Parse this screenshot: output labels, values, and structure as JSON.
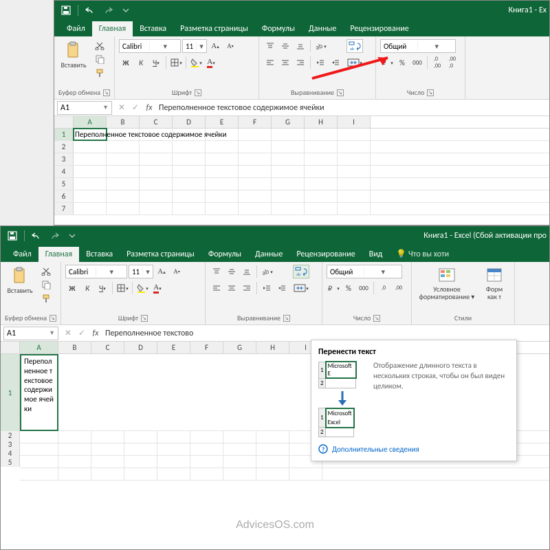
{
  "app": {
    "title1": "Книга1 - Ex",
    "title2": "Книга1 - Excel (Сбой активации про"
  },
  "tabs": {
    "file": "Файл",
    "home": "Главная",
    "insert": "Вставка",
    "layout": "Разметка страницы",
    "formulas": "Формулы",
    "data": "Данные",
    "review": "Рецензирование",
    "view": "Вид",
    "tell": "Что вы хоти"
  },
  "ribbon": {
    "paste": "Вставить",
    "clipboard": "Буфер обмена",
    "font": "Шрифт",
    "fontname": "Calibri",
    "fontsize": "11",
    "alignment": "Выравнивание",
    "number": "Число",
    "numfmt": "Общий",
    "styles": "Стили",
    "condfmt": "Условное",
    "condfmt2": "форматирование",
    "fmtas": "Форм",
    "fmtas2": "как т"
  },
  "fm": {
    "ref": "A1",
    "val": "Переполненное текстовое содержимое ячейки",
    "val2": "Переполненное текстово"
  },
  "cols": [
    "A",
    "B",
    "C",
    "D",
    "E",
    "F",
    "G",
    "H",
    "I"
  ],
  "rows1": [
    "1",
    "2",
    "3",
    "4",
    "5",
    "6",
    "7"
  ],
  "rows2": [
    "1",
    "2",
    "3",
    "4",
    "5"
  ],
  "cell_a1": "Переполненное текстовое содержимое ячейки",
  "cell_wrapped": "Переполненное текстовое содержимое ячейки",
  "tooltip": {
    "title": "Перенести текст",
    "text": "Отображение длинного текста в нескольких строках, чтобы он был виден целиком.",
    "more": "Дополнительные сведения",
    "d1": "Microsoft E",
    "d2": "Microsoft",
    "d3": "Excel"
  },
  "watermark": "AdvicesOS.com"
}
